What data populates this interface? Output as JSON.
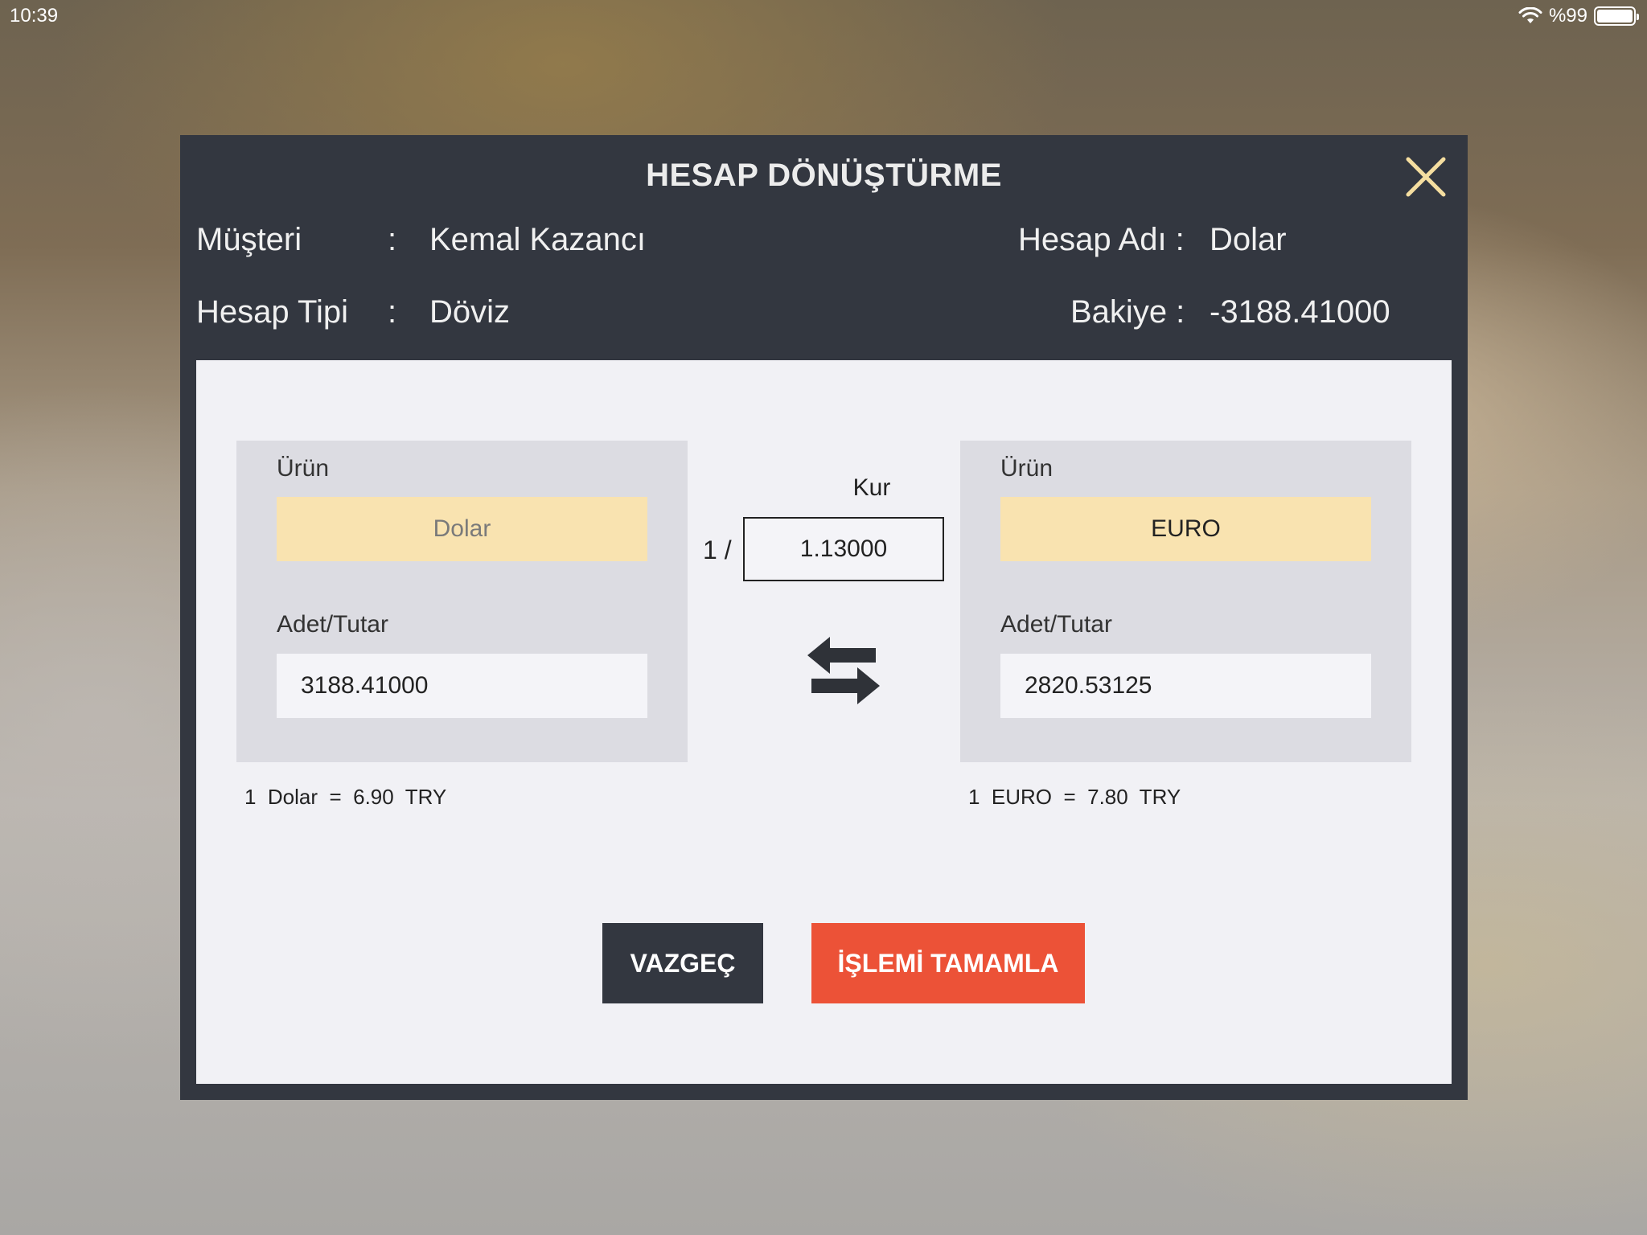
{
  "status": {
    "time": "10:39",
    "battery": "%99"
  },
  "dialog": {
    "title": "HESAP DÖNÜŞTÜRME",
    "customer_label": "Müşteri",
    "customer_colon": ":",
    "customer_value": "Kemal Kazancı",
    "account_type_label": "Hesap Tipi",
    "account_type_colon": ":",
    "account_type_value": "Döviz",
    "account_name_label": "Hesap Adı :",
    "account_name_value": "Dolar",
    "balance_label": "Bakiye :",
    "balance_value": "-3188.41000"
  },
  "source": {
    "product_label": "Ürün",
    "product_value": "Dolar",
    "amount_label": "Adet/Tutar",
    "amount_value": "3188.41000",
    "rate_note": "1  Dolar  =  6.90  TRY",
    "product_text_color": "#7a7a7a"
  },
  "target": {
    "product_label": "Ürün",
    "product_value": "EURO",
    "amount_label": "Adet/Tutar",
    "amount_value": "2820.53125",
    "rate_note": "1  EURO  =  7.80  TRY",
    "product_text_color": "#222222"
  },
  "exchange": {
    "label": "Kur",
    "prefix": "1 /",
    "value": "1.13000",
    "icon": "swap-arrows-icon"
  },
  "actions": {
    "cancel_label": "VAZGEÇ",
    "complete_label": "İŞLEMİ TAMAMLA"
  },
  "colors": {
    "header_bg": "#333740",
    "content_bg": "#f1f1f5",
    "panel_bg": "#dcdce2",
    "product_bg": "#f9e3b0",
    "close_icon": "#f5dea0",
    "complete_button": "#ec5237",
    "cancel_button": "#333740"
  }
}
